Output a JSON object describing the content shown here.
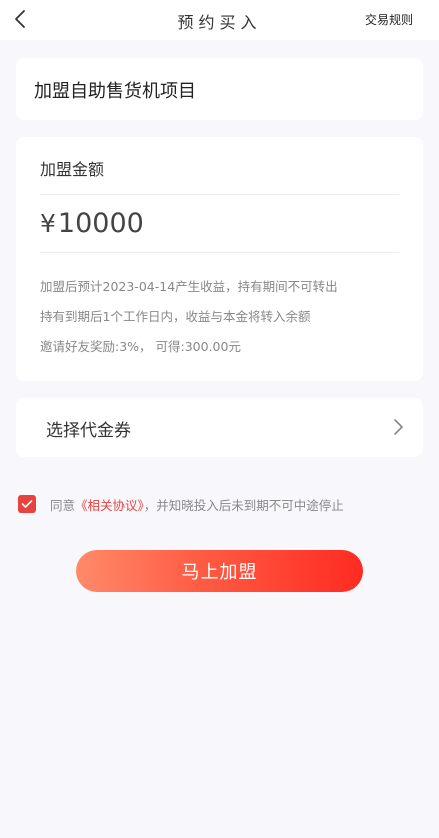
{
  "header": {
    "title": "预约买入",
    "rule_link": "交易规则"
  },
  "project": {
    "title": "加盟自助售货机项目"
  },
  "amount": {
    "label": "加盟金额",
    "currency": "¥",
    "value": "10000",
    "notes": [
      "加盟后预计2023-04-14产生收益，持有期间不可转出",
      "持有到期后1个工作日内，收益与本金将转入余额",
      "邀请好友奖励:3%， 可得:300.00元"
    ]
  },
  "voucher": {
    "label": "选择代金券"
  },
  "agreement": {
    "checked": true,
    "prefix": "同意",
    "link": "《相关协议》",
    "suffix": "，并知晓投入后未到期不可中途停止"
  },
  "submit": {
    "label": "马上加盟"
  },
  "colors": {
    "accent": "#e8423f",
    "button_start": "#ff8a6a",
    "button_end": "#ff2b22",
    "background": "#f8f8fc"
  }
}
